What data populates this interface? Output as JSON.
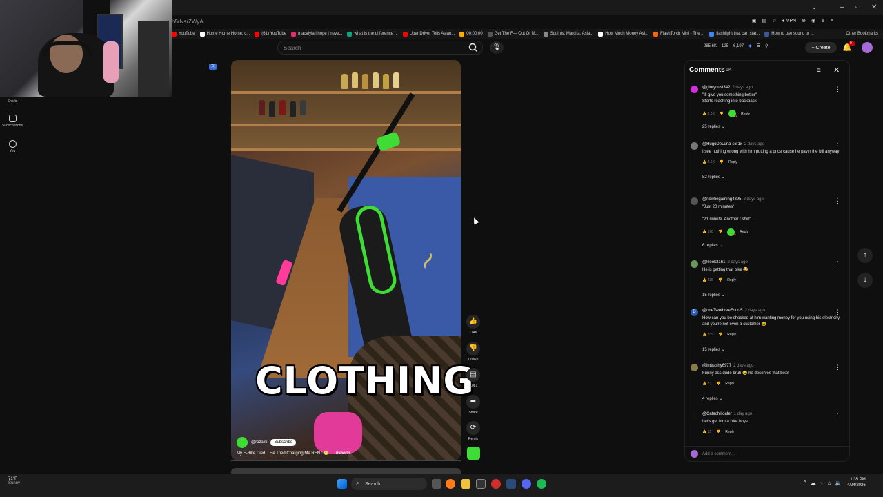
{
  "browser": {
    "url_fragment": "h5rNsrZWyA",
    "vpn_label": "VPN",
    "bookmarks": [
      {
        "label": "YouTube",
        "color": "#ff0000"
      },
      {
        "label": "Home Home Home; c...",
        "color": "#ffffff"
      },
      {
        "label": "(61) YouTube",
        "color": "#ff0000"
      },
      {
        "label": "macaiyla i hope i neve...",
        "color": "#e1306c"
      },
      {
        "label": "what is the difference ...",
        "color": "#10a37f"
      },
      {
        "label": "Uber Driver Tells Asian...",
        "color": "#ff0000"
      },
      {
        "label": "00:00:00",
        "color": "#ffaa00"
      },
      {
        "label": "Get The F— Out Of M...",
        "color": "#555555"
      },
      {
        "label": "Squints, Marcita, Asia...",
        "color": "#888888"
      },
      {
        "label": "How Much Money Asi...",
        "color": "#ffffff"
      },
      {
        "label": "FlashTorch Mini - The ...",
        "color": "#ff6600"
      },
      {
        "label": "flashlight that can star...",
        "color": "#4285f4"
      },
      {
        "label": "How to use sound to ...",
        "color": "#3b5998"
      }
    ],
    "other_bookmarks": "Other Bookmarks"
  },
  "sidebar": {
    "items": [
      {
        "label": "Shorts"
      },
      {
        "label": "Subscriptions"
      },
      {
        "label": "You"
      }
    ]
  },
  "header": {
    "search_placeholder": "Search",
    "stats": [
      "285.6K",
      "125",
      "6,197"
    ],
    "create_label": "Create",
    "notification_count": "9+"
  },
  "video": {
    "caption": "CLOTHING",
    "channel": "@rozaiiti",
    "subscribe_label": "Subscribe",
    "title": "My E-Bike Died... He Tried Charging Me RENT 😳",
    "hashtag": "#shorts"
  },
  "actions": {
    "like_count": "114K",
    "dislike_label": "Dislike",
    "comment_count": "1,081",
    "share_label": "Share",
    "remix_label": "Remix"
  },
  "comments": {
    "title": "Comments",
    "count": "1K",
    "add_placeholder": "Add a comment...",
    "items": [
      {
        "user": "@glorynust342",
        "time": "2 days ago",
        "lines": [
          "\"Ill give you something better\"",
          "Starts reaching into backpack"
        ],
        "likes": "2.8K",
        "replies": "25 replies",
        "avatar": "#d62de0",
        "creator_heart": true
      },
      {
        "user": "@HugoDeLuna-s6f1x",
        "time": "2 days ago",
        "lines": [
          "I see nothing wrong with him putting a price cause he payin the bill anyway"
        ],
        "likes": "2.6K",
        "replies": "82 replies",
        "avatar": "#777777",
        "creator_heart": false
      },
      {
        "user": "@newfiegaming4895",
        "time": "2 days ago",
        "lines": [
          "\"Just 20 minutes\"",
          "",
          "\"21 minute. Another t shirt\""
        ],
        "likes": "578",
        "replies": "6 replies",
        "avatar": "#555555",
        "creator_heart": true
      },
      {
        "user": "@kleok3161",
        "time": "2 days ago",
        "lines": [
          "He is getting that bike 😂"
        ],
        "likes": "435",
        "replies": "15 replies",
        "avatar": "#6a9a5a",
        "creator_heart": false
      },
      {
        "user": "@oneTwothreeFour-5",
        "time": "2 days ago",
        "lines": [
          "How can you be shocked at him wanting money for you using his electricity and you're not even a customer 😂"
        ],
        "likes": "239",
        "replies": "15 replies",
        "avatar": "#2b5cad",
        "avatar_letter": "D",
        "creator_heart": false
      },
      {
        "user": "@imtrashy6977",
        "time": "2 days ago",
        "lines": [
          "Funny ass dude bruh 😂 he deserves that bike!"
        ],
        "likes": "73",
        "replies": "4 replies",
        "avatar": "#8a7a4a",
        "creator_heart": false
      },
      {
        "user": "@Catachilloafer",
        "time": "1 day ago",
        "lines": [
          "Let's get him a bike boys"
        ],
        "likes": "15",
        "replies": "",
        "avatar": "#111111",
        "creator_heart": false
      }
    ],
    "reply_label": "Reply"
  },
  "taskbar": {
    "temperature": "71°F",
    "weather": "Sunny",
    "search_label": "Search",
    "time": "1:35 PM",
    "date": "4/24/2026"
  }
}
